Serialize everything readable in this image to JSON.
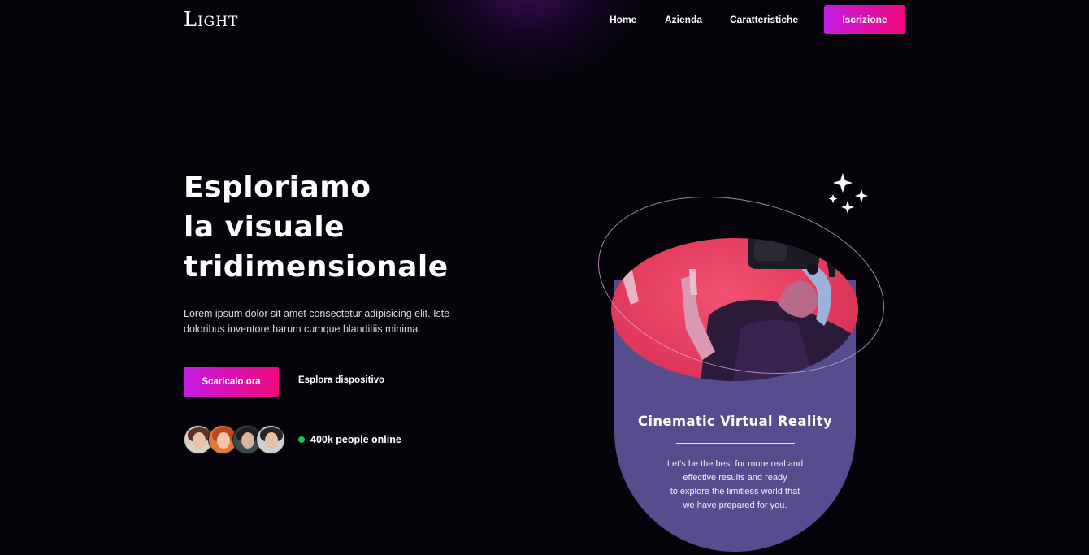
{
  "nav": {
    "logo": "Light",
    "links": [
      "Home",
      "Azienda",
      "Caratteristiche"
    ],
    "cta": "Iscrizione"
  },
  "hero": {
    "title_lines": [
      "Esploriamo",
      "la visuale",
      "tridimensionale"
    ],
    "description": "Lorem ipsum dolor sit amet consectetur adipisicing elit. Iste doloribus inventore harum cumque blanditiis minima.",
    "primary_button": "Scaricalo ora",
    "secondary_button": "Esplora dispositivo",
    "online_text": "400k people online"
  },
  "card": {
    "title": "Cinematic Virtual Reality",
    "text_lines": [
      "Let's be the best for more real and",
      "effective results and ready",
      "to explore the limitless world that",
      "we have prepared for you."
    ]
  },
  "colors": {
    "background": "#05040b",
    "accent_start": "#c21ce0",
    "accent_end": "#f0097d",
    "card": "#574c8e",
    "card_top": "#e33a5c",
    "online_dot": "#1bc45b"
  }
}
